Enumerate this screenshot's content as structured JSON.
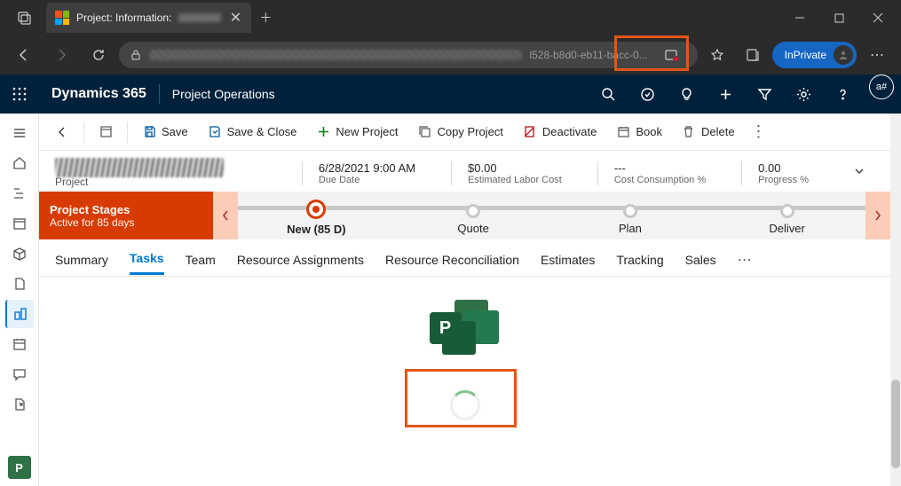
{
  "browser": {
    "tab_title": "Project: Information:",
    "url_visible": "l528-b8d0-eb11-bacc-0...",
    "inprivate_label": "InPrivate"
  },
  "dynamics": {
    "brand": "Dynamics 365",
    "area": "Project Operations",
    "avatar": "a#"
  },
  "commands": {
    "save": "Save",
    "save_close": "Save & Close",
    "new_project": "New Project",
    "copy_project": "Copy Project",
    "deactivate": "Deactivate",
    "book": "Book",
    "delete": "Delete"
  },
  "header": {
    "subtitle": "Project",
    "stats": [
      {
        "value": "6/28/2021 9:00 AM",
        "label": "Due Date"
      },
      {
        "value": "$0.00",
        "label": "Estimated Labor Cost"
      },
      {
        "value": "---",
        "label": "Cost Consumption %"
      },
      {
        "value": "0.00",
        "label": "Progress %"
      }
    ]
  },
  "stages": {
    "title": "Project Stages",
    "subtitle": "Active for 85 days",
    "current_suffix": " (85 D)",
    "items": [
      "New",
      "Quote",
      "Plan",
      "Deliver"
    ]
  },
  "tabs": [
    "Summary",
    "Tasks",
    "Team",
    "Resource Assignments",
    "Resource Reconciliation",
    "Estimates",
    "Tracking",
    "Sales"
  ],
  "project_logo_letter": "P",
  "rail_logo_letter": "P"
}
